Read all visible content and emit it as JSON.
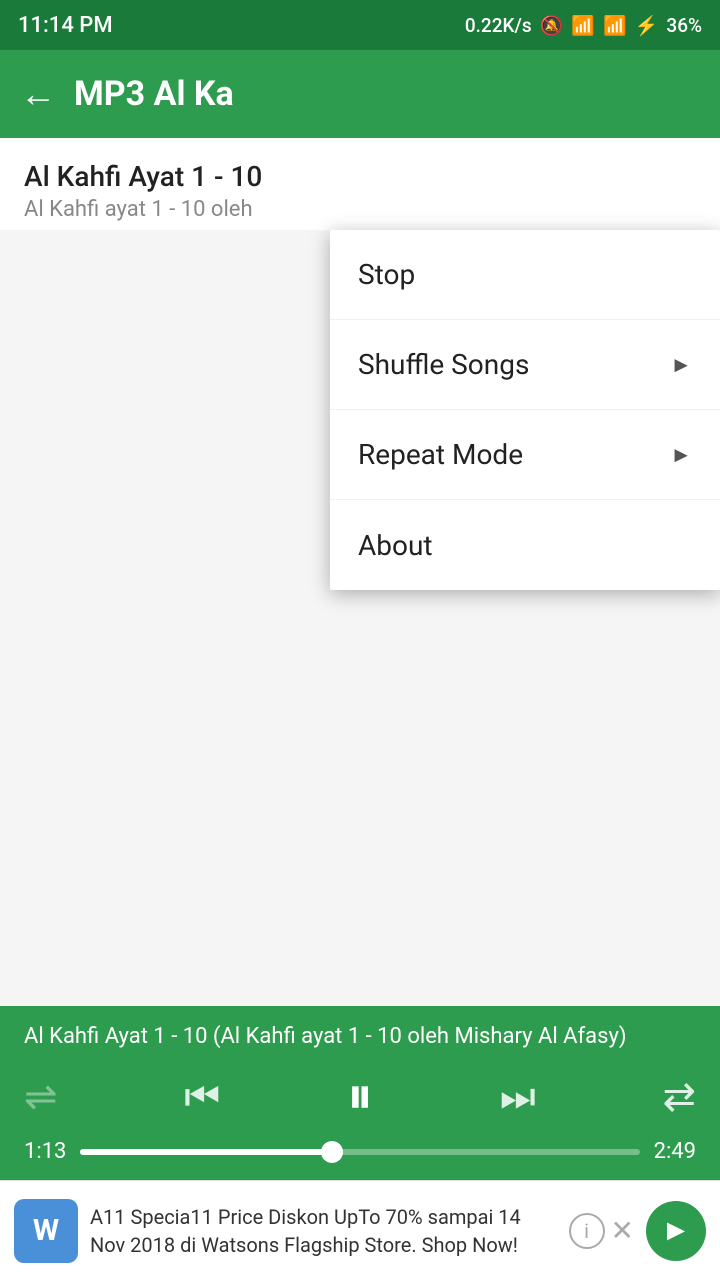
{
  "statusBar": {
    "time": "11:14 PM",
    "network": "0.22K/s",
    "battery": "36%"
  },
  "appBar": {
    "title": "MP3 Al Ka",
    "backLabel": "←"
  },
  "song": {
    "title": "Al Kahfi Ayat 1 - 10",
    "subtitle": "Al Kahfi ayat 1 - 10 oleh"
  },
  "menu": {
    "items": [
      {
        "label": "Stop",
        "hasArrow": false
      },
      {
        "label": "Shuffle Songs",
        "hasArrow": true
      },
      {
        "label": "Repeat Mode",
        "hasArrow": true
      },
      {
        "label": "About",
        "hasArrow": false
      }
    ]
  },
  "player": {
    "songTitle": "Al Kahfi Ayat 1 - 10 (Al Kahfi ayat 1 - 10 oleh Mishary Al Afasy)",
    "currentTime": "1:13",
    "totalTime": "2:49",
    "progressPercent": 45
  },
  "ad": {
    "logoLetter": "W",
    "text": "A11 Specia11 Price Diskon UpTo 70% sampai 14 Nov 2018 di Watsons Flagship Store. Shop Now!"
  }
}
